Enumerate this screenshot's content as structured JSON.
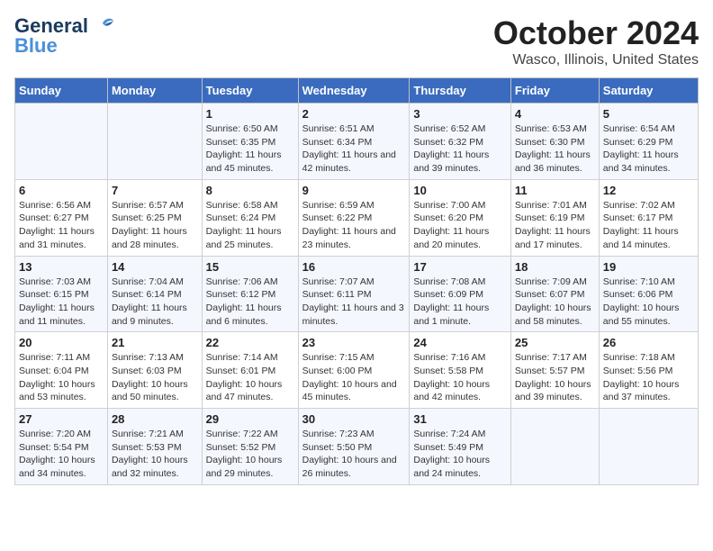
{
  "logo": {
    "line1": "General",
    "line2": "Blue"
  },
  "title": "October 2024",
  "subtitle": "Wasco, Illinois, United States",
  "days_of_week": [
    "Sunday",
    "Monday",
    "Tuesday",
    "Wednesday",
    "Thursday",
    "Friday",
    "Saturday"
  ],
  "weeks": [
    [
      {
        "day": "",
        "info": ""
      },
      {
        "day": "",
        "info": ""
      },
      {
        "day": "1",
        "info": "Sunrise: 6:50 AM\nSunset: 6:35 PM\nDaylight: 11 hours and 45 minutes."
      },
      {
        "day": "2",
        "info": "Sunrise: 6:51 AM\nSunset: 6:34 PM\nDaylight: 11 hours and 42 minutes."
      },
      {
        "day": "3",
        "info": "Sunrise: 6:52 AM\nSunset: 6:32 PM\nDaylight: 11 hours and 39 minutes."
      },
      {
        "day": "4",
        "info": "Sunrise: 6:53 AM\nSunset: 6:30 PM\nDaylight: 11 hours and 36 minutes."
      },
      {
        "day": "5",
        "info": "Sunrise: 6:54 AM\nSunset: 6:29 PM\nDaylight: 11 hours and 34 minutes."
      }
    ],
    [
      {
        "day": "6",
        "info": "Sunrise: 6:56 AM\nSunset: 6:27 PM\nDaylight: 11 hours and 31 minutes."
      },
      {
        "day": "7",
        "info": "Sunrise: 6:57 AM\nSunset: 6:25 PM\nDaylight: 11 hours and 28 minutes."
      },
      {
        "day": "8",
        "info": "Sunrise: 6:58 AM\nSunset: 6:24 PM\nDaylight: 11 hours and 25 minutes."
      },
      {
        "day": "9",
        "info": "Sunrise: 6:59 AM\nSunset: 6:22 PM\nDaylight: 11 hours and 23 minutes."
      },
      {
        "day": "10",
        "info": "Sunrise: 7:00 AM\nSunset: 6:20 PM\nDaylight: 11 hours and 20 minutes."
      },
      {
        "day": "11",
        "info": "Sunrise: 7:01 AM\nSunset: 6:19 PM\nDaylight: 11 hours and 17 minutes."
      },
      {
        "day": "12",
        "info": "Sunrise: 7:02 AM\nSunset: 6:17 PM\nDaylight: 11 hours and 14 minutes."
      }
    ],
    [
      {
        "day": "13",
        "info": "Sunrise: 7:03 AM\nSunset: 6:15 PM\nDaylight: 11 hours and 11 minutes."
      },
      {
        "day": "14",
        "info": "Sunrise: 7:04 AM\nSunset: 6:14 PM\nDaylight: 11 hours and 9 minutes."
      },
      {
        "day": "15",
        "info": "Sunrise: 7:06 AM\nSunset: 6:12 PM\nDaylight: 11 hours and 6 minutes."
      },
      {
        "day": "16",
        "info": "Sunrise: 7:07 AM\nSunset: 6:11 PM\nDaylight: 11 hours and 3 minutes."
      },
      {
        "day": "17",
        "info": "Sunrise: 7:08 AM\nSunset: 6:09 PM\nDaylight: 11 hours and 1 minute."
      },
      {
        "day": "18",
        "info": "Sunrise: 7:09 AM\nSunset: 6:07 PM\nDaylight: 10 hours and 58 minutes."
      },
      {
        "day": "19",
        "info": "Sunrise: 7:10 AM\nSunset: 6:06 PM\nDaylight: 10 hours and 55 minutes."
      }
    ],
    [
      {
        "day": "20",
        "info": "Sunrise: 7:11 AM\nSunset: 6:04 PM\nDaylight: 10 hours and 53 minutes."
      },
      {
        "day": "21",
        "info": "Sunrise: 7:13 AM\nSunset: 6:03 PM\nDaylight: 10 hours and 50 minutes."
      },
      {
        "day": "22",
        "info": "Sunrise: 7:14 AM\nSunset: 6:01 PM\nDaylight: 10 hours and 47 minutes."
      },
      {
        "day": "23",
        "info": "Sunrise: 7:15 AM\nSunset: 6:00 PM\nDaylight: 10 hours and 45 minutes."
      },
      {
        "day": "24",
        "info": "Sunrise: 7:16 AM\nSunset: 5:58 PM\nDaylight: 10 hours and 42 minutes."
      },
      {
        "day": "25",
        "info": "Sunrise: 7:17 AM\nSunset: 5:57 PM\nDaylight: 10 hours and 39 minutes."
      },
      {
        "day": "26",
        "info": "Sunrise: 7:18 AM\nSunset: 5:56 PM\nDaylight: 10 hours and 37 minutes."
      }
    ],
    [
      {
        "day": "27",
        "info": "Sunrise: 7:20 AM\nSunset: 5:54 PM\nDaylight: 10 hours and 34 minutes."
      },
      {
        "day": "28",
        "info": "Sunrise: 7:21 AM\nSunset: 5:53 PM\nDaylight: 10 hours and 32 minutes."
      },
      {
        "day": "29",
        "info": "Sunrise: 7:22 AM\nSunset: 5:52 PM\nDaylight: 10 hours and 29 minutes."
      },
      {
        "day": "30",
        "info": "Sunrise: 7:23 AM\nSunset: 5:50 PM\nDaylight: 10 hours and 26 minutes."
      },
      {
        "day": "31",
        "info": "Sunrise: 7:24 AM\nSunset: 5:49 PM\nDaylight: 10 hours and 24 minutes."
      },
      {
        "day": "",
        "info": ""
      },
      {
        "day": "",
        "info": ""
      }
    ]
  ]
}
